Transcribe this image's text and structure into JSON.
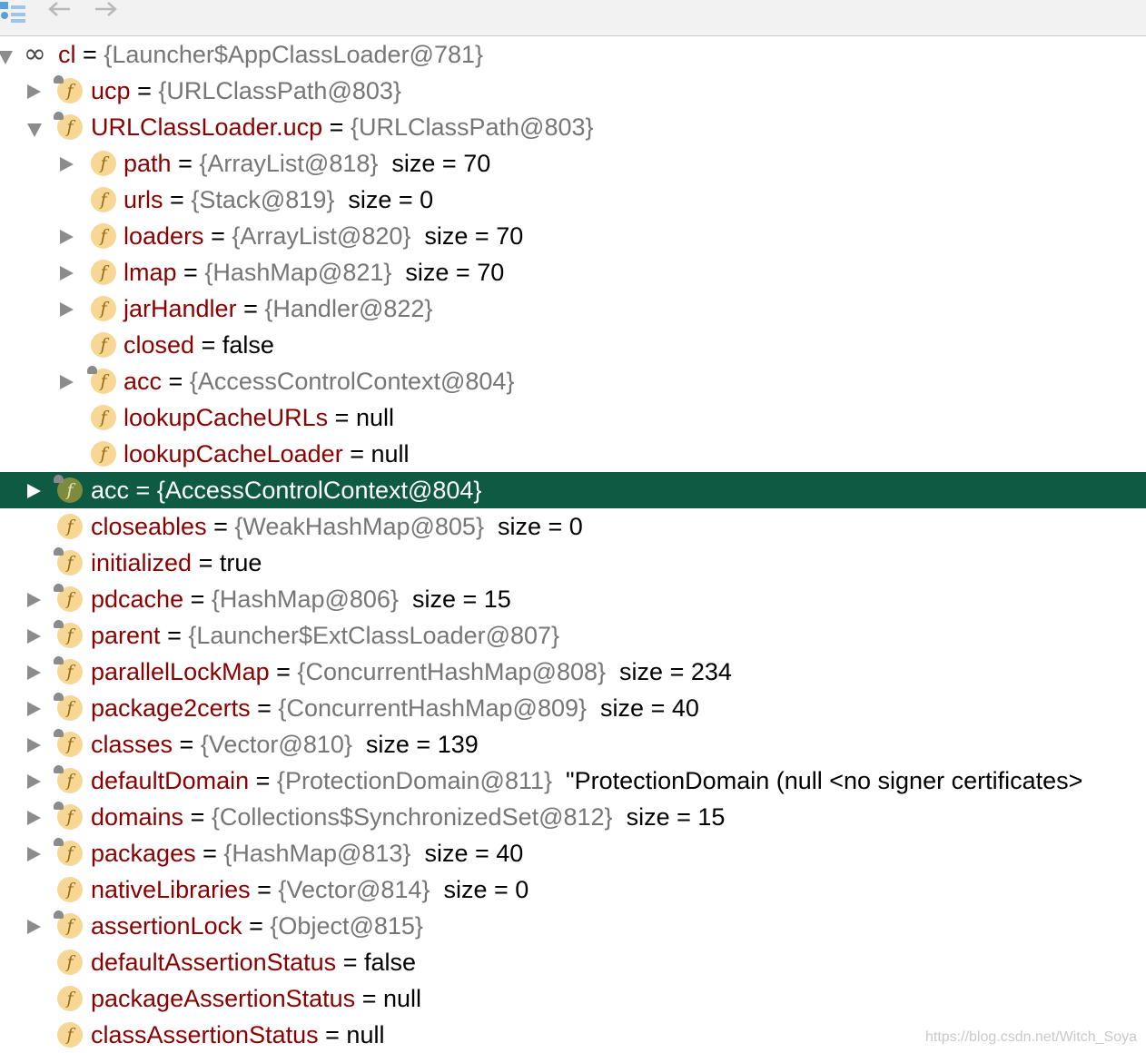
{
  "toolbar": {
    "icons": [
      "variables-layout-icon",
      "back-arrow-icon",
      "forward-arrow-icon"
    ]
  },
  "tree": [
    {
      "name": "cl",
      "eq": "=",
      "ref": "{Launcher$AppClassLoader@781}",
      "value": "",
      "size": "",
      "toggle": "expanded",
      "icon": "watch",
      "depth": 0
    },
    {
      "name": "ucp",
      "eq": "=",
      "ref": "{URLClassPath@803}",
      "value": "",
      "size": "",
      "toggle": "collapsed",
      "icon": "field-lock",
      "depth": 1
    },
    {
      "name": "URLClassLoader.ucp",
      "eq": "=",
      "ref": "{URLClassPath@803}",
      "value": "",
      "size": "",
      "toggle": "expanded",
      "icon": "field-lock",
      "depth": 1
    },
    {
      "name": "path",
      "eq": "=",
      "ref": "{ArrayList@818}",
      "value": "",
      "size": "size = 70",
      "toggle": "collapsed",
      "icon": "field",
      "depth": 2
    },
    {
      "name": "urls",
      "eq": "=",
      "ref": "{Stack@819}",
      "value": "",
      "size": "size = 0",
      "toggle": "none",
      "icon": "field",
      "depth": 2
    },
    {
      "name": "loaders",
      "eq": "=",
      "ref": "{ArrayList@820}",
      "value": "",
      "size": "size = 70",
      "toggle": "collapsed",
      "icon": "field",
      "depth": 2
    },
    {
      "name": "lmap",
      "eq": "=",
      "ref": "{HashMap@821}",
      "value": "",
      "size": "size = 70",
      "toggle": "collapsed",
      "icon": "field",
      "depth": 2
    },
    {
      "name": "jarHandler",
      "eq": "=",
      "ref": "{Handler@822}",
      "value": "",
      "size": "",
      "toggle": "collapsed",
      "icon": "field",
      "depth": 2
    },
    {
      "name": "closed",
      "eq": "=",
      "ref": "",
      "value": "false",
      "size": "",
      "toggle": "none",
      "icon": "field",
      "depth": 2
    },
    {
      "name": "acc",
      "eq": "=",
      "ref": "{AccessControlContext@804}",
      "value": "",
      "size": "",
      "toggle": "collapsed",
      "icon": "field-lock",
      "depth": 2
    },
    {
      "name": "lookupCacheURLs",
      "eq": "=",
      "ref": "",
      "value": "null",
      "size": "",
      "toggle": "none",
      "icon": "field",
      "depth": 2
    },
    {
      "name": "lookupCacheLoader",
      "eq": "=",
      "ref": "",
      "value": "null",
      "size": "",
      "toggle": "none",
      "icon": "field",
      "depth": 2
    },
    {
      "name": "acc",
      "eq": "=",
      "ref": "{AccessControlContext@804}",
      "value": "",
      "size": "",
      "toggle": "collapsed",
      "icon": "field-lock",
      "depth": 1,
      "selected": true
    },
    {
      "name": "closeables",
      "eq": "=",
      "ref": "{WeakHashMap@805}",
      "value": "",
      "size": "size = 0",
      "toggle": "none",
      "icon": "field",
      "depth": 1
    },
    {
      "name": "initialized",
      "eq": "=",
      "ref": "",
      "value": "true",
      "size": "",
      "toggle": "none",
      "icon": "field-lock",
      "depth": 1
    },
    {
      "name": "pdcache",
      "eq": "=",
      "ref": "{HashMap@806}",
      "value": "",
      "size": "size = 15",
      "toggle": "collapsed",
      "icon": "field-lock",
      "depth": 1
    },
    {
      "name": "parent",
      "eq": "=",
      "ref": "{Launcher$ExtClassLoader@807}",
      "value": "",
      "size": "",
      "toggle": "collapsed",
      "icon": "field-lock",
      "depth": 1
    },
    {
      "name": "parallelLockMap",
      "eq": "=",
      "ref": "{ConcurrentHashMap@808}",
      "value": "",
      "size": "size = 234",
      "toggle": "collapsed",
      "icon": "field-lock",
      "depth": 1
    },
    {
      "name": "package2certs",
      "eq": "=",
      "ref": "{ConcurrentHashMap@809}",
      "value": "",
      "size": "size = 40",
      "toggle": "collapsed",
      "icon": "field-lock",
      "depth": 1
    },
    {
      "name": "classes",
      "eq": "=",
      "ref": "{Vector@810}",
      "value": "",
      "size": "size = 139",
      "toggle": "collapsed",
      "icon": "field-lock",
      "depth": 1
    },
    {
      "name": "defaultDomain",
      "eq": "=",
      "ref": "{ProtectionDomain@811}",
      "value": "\"ProtectionDomain  (null <no signer certificates>",
      "size": "",
      "toggle": "collapsed",
      "icon": "field-lock",
      "depth": 1
    },
    {
      "name": "domains",
      "eq": "=",
      "ref": "{Collections$SynchronizedSet@812}",
      "value": "",
      "size": "size = 15",
      "toggle": "collapsed",
      "icon": "field-lock",
      "depth": 1
    },
    {
      "name": "packages",
      "eq": "=",
      "ref": "{HashMap@813}",
      "value": "",
      "size": "size = 40",
      "toggle": "collapsed",
      "icon": "field-lock",
      "depth": 1
    },
    {
      "name": "nativeLibraries",
      "eq": "=",
      "ref": "{Vector@814}",
      "value": "",
      "size": "size = 0",
      "toggle": "none",
      "icon": "field",
      "depth": 1
    },
    {
      "name": "assertionLock",
      "eq": "=",
      "ref": "{Object@815}",
      "value": "",
      "size": "",
      "toggle": "collapsed",
      "icon": "field-lock",
      "depth": 1
    },
    {
      "name": "defaultAssertionStatus",
      "eq": "=",
      "ref": "",
      "value": "false",
      "size": "",
      "toggle": "none",
      "icon": "field",
      "depth": 1
    },
    {
      "name": "packageAssertionStatus",
      "eq": "=",
      "ref": "",
      "value": "null",
      "size": "",
      "toggle": "none",
      "icon": "field",
      "depth": 1
    },
    {
      "name": "classAssertionStatus",
      "eq": "=",
      "ref": "",
      "value": "null",
      "size": "",
      "toggle": "none",
      "icon": "field",
      "depth": 1
    }
  ],
  "icon_glyph": "f",
  "watermark": "https://blog.csdn.net/Witch_Soya",
  "colors": {
    "selected_row": "#0e5a42",
    "field_name": "#8b0000",
    "reference": "#767676",
    "field_icon": "#f6d795"
  }
}
